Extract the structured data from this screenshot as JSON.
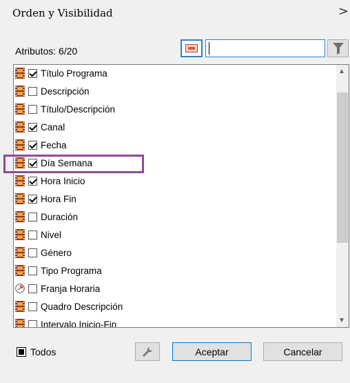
{
  "window": {
    "title": "Orden y Visibilidad",
    "close_glyph": ">"
  },
  "attributes_label": "Atributos: 6/20",
  "search": {
    "value": ""
  },
  "items": [
    {
      "label": "Título Programa",
      "checked": true,
      "icon": "film-icon"
    },
    {
      "label": "Descripción",
      "checked": false,
      "icon": "film-icon"
    },
    {
      "label": "Título/Descripción",
      "checked": false,
      "icon": "film-icon"
    },
    {
      "label": "Canal",
      "checked": true,
      "icon": "film-icon"
    },
    {
      "label": "Fecha",
      "checked": true,
      "icon": "film-icon"
    },
    {
      "label": "Día Semana",
      "checked": true,
      "icon": "film-icon"
    },
    {
      "label": "Hora Inicio",
      "checked": true,
      "icon": "film-icon"
    },
    {
      "label": "Hora Fin",
      "checked": true,
      "icon": "film-icon"
    },
    {
      "label": "Duración",
      "checked": false,
      "icon": "film-icon"
    },
    {
      "label": "Nivel",
      "checked": false,
      "icon": "film-icon"
    },
    {
      "label": "Género",
      "checked": false,
      "icon": "film-icon"
    },
    {
      "label": "Tipo Programa",
      "checked": false,
      "icon": "film-icon"
    },
    {
      "label": "Franja Horaria",
      "checked": false,
      "icon": "clock-icon"
    },
    {
      "label": "Quadro Descripción",
      "checked": false,
      "icon": "film-icon"
    },
    {
      "label": "Intervalo Inicio-Fin",
      "checked": false,
      "icon": "film-icon"
    }
  ],
  "footer": {
    "todos_label": "Todos",
    "accept_label": "Aceptar",
    "cancel_label": "Cancelar"
  },
  "colors": {
    "highlight": "#8e4a96",
    "focus": "#2b7fd4",
    "film": "#8b3a1a"
  }
}
